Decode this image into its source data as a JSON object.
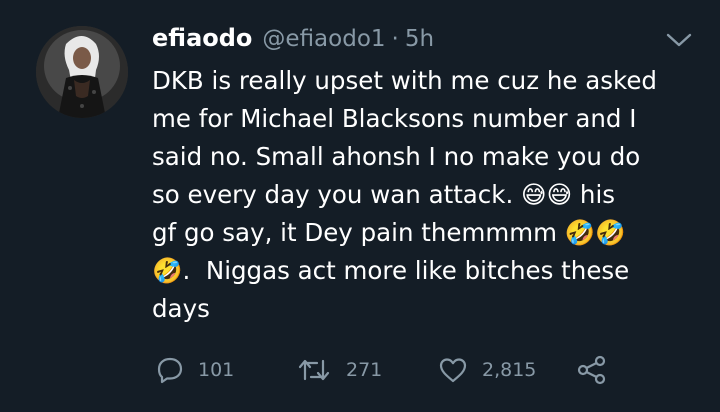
{
  "tweet": {
    "display_name": "efiaodo",
    "handle": "@efiaodo1",
    "separator": "·",
    "timestamp": "5h",
    "lines": [
      "DKB is really upset with me cuz he asked",
      "me for Michael Blacksons number and I",
      "said no. Small ahonsh I no make you do",
      "so every day you wan attack. 😅😅 his",
      "gf go say, it Dey pain themmmm 🤣🤣",
      "🤣.  Niggas act more like bitches these",
      "days"
    ]
  },
  "actions": {
    "reply_count": "101",
    "retweet_count": "271",
    "like_count": "2,815"
  },
  "icons": {
    "caret": "chevron-down-icon",
    "reply": "reply-icon",
    "retweet": "retweet-icon",
    "like": "heart-icon",
    "share": "share-icon"
  },
  "colors": {
    "background": "#141d26",
    "primary_text": "#ffffff",
    "secondary_text": "#8899a6"
  }
}
